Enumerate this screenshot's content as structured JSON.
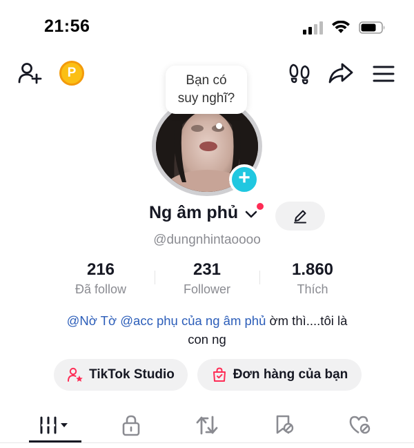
{
  "status_bar": {
    "time": "21:56",
    "icons": [
      "signal-icon",
      "wifi-icon",
      "battery-icon"
    ]
  },
  "top_bar": {
    "left_icons": [
      "add-friend-icon",
      "coin-icon"
    ],
    "coin_letter": "P",
    "right_icons": [
      "footprints-icon",
      "share-icon",
      "menu-icon"
    ]
  },
  "profile": {
    "thought_bubble": "Bạn có suy nghĩ?",
    "thought_line1": "Bạn có",
    "thought_line2": "suy nghĩ?",
    "name": "Ng âm phủ",
    "handle": "@dungnhintaoooo",
    "avatar_add_symbol": "+"
  },
  "stats": [
    {
      "value": "216",
      "label": "Đã follow"
    },
    {
      "value": "231",
      "label": "Follower"
    },
    {
      "value": "1.860",
      "label": "Thích"
    }
  ],
  "bio": {
    "mention1": "@Nờ Tờ",
    "mention2": "@acc phụ của ng âm phủ",
    "text_line1_rest": "ờm thì....tôi là",
    "text_line2": "con ng"
  },
  "buttons": {
    "studio": "TikTok Studio",
    "orders": "Đơn hàng của bạn"
  },
  "tabs": [
    {
      "icon": "grid-icon",
      "active": true
    },
    {
      "icon": "lock-icon",
      "active": false
    },
    {
      "icon": "repost-icon",
      "active": false
    },
    {
      "icon": "bookmark-icon",
      "active": false
    },
    {
      "icon": "liked-icon",
      "active": false
    }
  ],
  "colors": {
    "accent_cyan": "#20c7e0",
    "mention_blue": "#2b5db9",
    "notification_red": "#fe2c55",
    "coin_yellow": "#fbbf14"
  }
}
